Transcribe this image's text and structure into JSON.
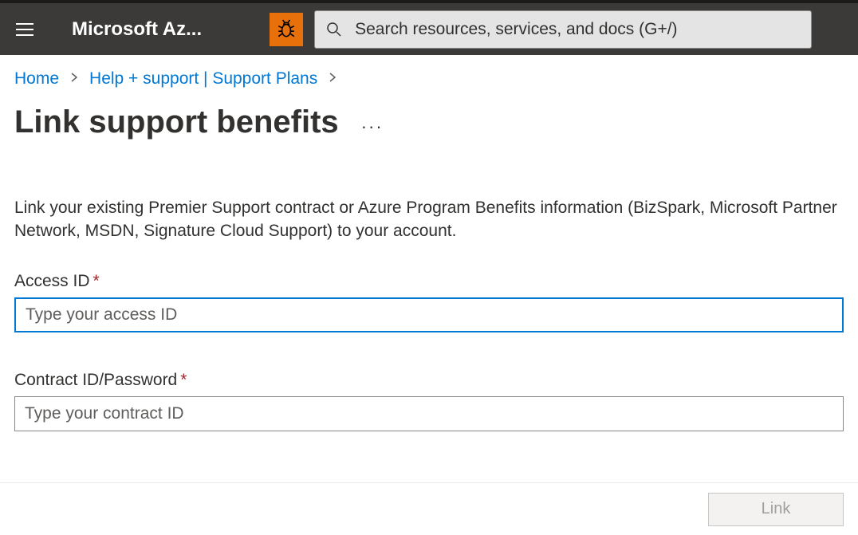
{
  "header": {
    "brand": "Microsoft Az...",
    "search_placeholder": "Search resources, services, and docs (G+/)"
  },
  "breadcrumb": {
    "home": "Home",
    "help_support": "Help + support | Support Plans"
  },
  "page": {
    "title": "Link support benefits",
    "description": "Link your existing Premier Support contract or Azure Program Benefits information (BizSpark, Microsoft Partner Network, MSDN, Signature Cloud Support) to your account."
  },
  "form": {
    "access_id": {
      "label": "Access ID",
      "placeholder": "Type your access ID"
    },
    "contract_id": {
      "label": "Contract ID/Password",
      "placeholder": "Type your contract ID"
    }
  },
  "footer": {
    "link_label": "Link"
  }
}
